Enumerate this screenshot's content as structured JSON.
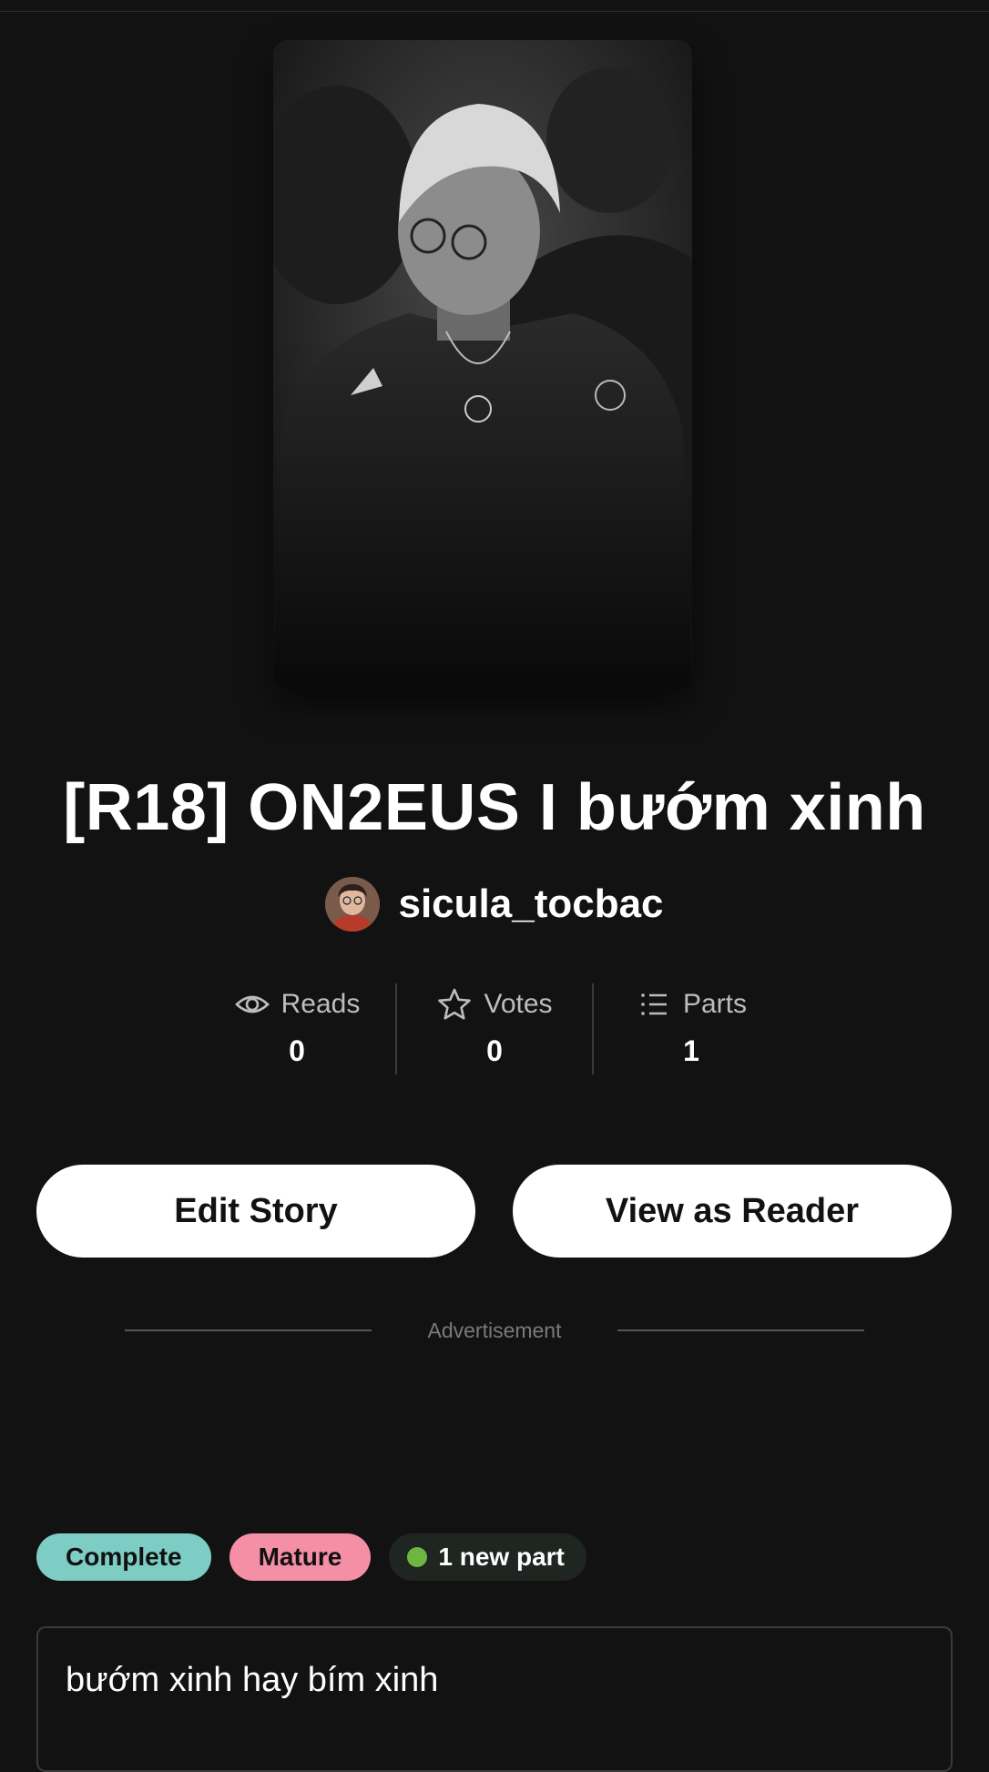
{
  "story": {
    "title": "[R18] ON2EUS I bướm xinh",
    "author": "sicula_tocbac",
    "description": "bướm xinh hay bím xinh"
  },
  "stats": [
    {
      "label": "Reads",
      "value": "0",
      "icon": "eye-icon"
    },
    {
      "label": "Votes",
      "value": "0",
      "icon": "star-icon"
    },
    {
      "label": "Parts",
      "value": "1",
      "icon": "list-icon"
    }
  ],
  "actions": {
    "edit_label": "Edit Story",
    "view_label": "View as Reader"
  },
  "ad": {
    "label": "Advertisement"
  },
  "tags": {
    "complete": "Complete",
    "mature": "Mature",
    "new_parts": "1 new part"
  },
  "colors": {
    "background": "#121212",
    "tag_complete": "#7ecdc5",
    "tag_mature": "#f48fa6",
    "new_dot": "#6fb541"
  }
}
